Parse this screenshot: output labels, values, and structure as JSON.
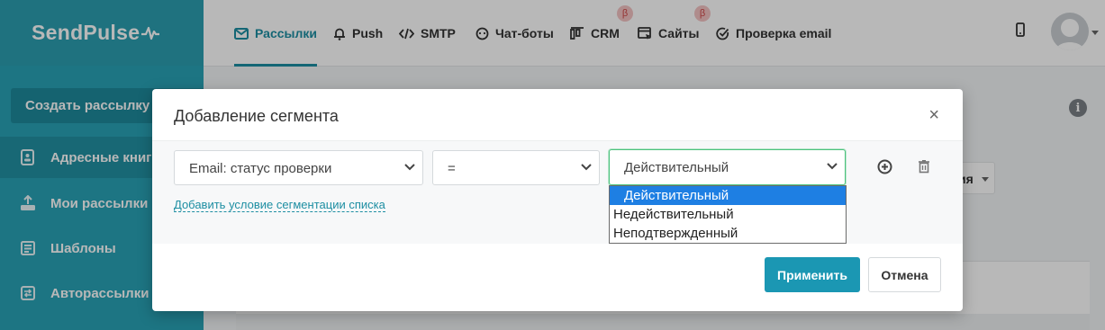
{
  "app": {
    "logo": "SendPulse"
  },
  "sidebar": {
    "create_button": "Создать рассылку",
    "items": [
      {
        "label": "Адресные книги",
        "icon": "address-book-icon"
      },
      {
        "label": "Мои рассылки",
        "icon": "paper-plane-icon"
      },
      {
        "label": "Шаблоны",
        "icon": "template-icon"
      },
      {
        "label": "Авторассылки",
        "icon": "automation-icon"
      }
    ]
  },
  "topnav": {
    "tabs": [
      {
        "label": "Рассылки",
        "icon": "envelope-icon",
        "active": true
      },
      {
        "label": "Push",
        "icon": "bell-icon"
      },
      {
        "label": "SMTP",
        "icon": "code-icon"
      },
      {
        "label": "Чат-боты",
        "icon": "chat-bot-icon"
      },
      {
        "label": "CRM",
        "icon": "crm-icon",
        "badge": "β"
      },
      {
        "label": "Сайты",
        "icon": "site-icon",
        "badge": "β"
      },
      {
        "label": "Проверка email",
        "icon": "check-circle-icon"
      }
    ]
  },
  "background": {
    "info_icon": "i",
    "dropdown_text": "ия"
  },
  "modal": {
    "title": "Добавление сегмента",
    "close": "×",
    "field_select": "Email: статус проверки",
    "operator_select": "=",
    "value_select": "Действительный",
    "value_options": [
      "Действительный",
      "Недействительный",
      "Неподтвержденный"
    ],
    "add_condition_link": "Добавить условие сегментации списка",
    "apply_button": "Применить",
    "cancel_button": "Отмена"
  },
  "colors": {
    "brand": "#29a3b6",
    "accent": "#1d8ea2",
    "primary_button": "#1b97b3",
    "selected_option": "#1e7fe3"
  }
}
